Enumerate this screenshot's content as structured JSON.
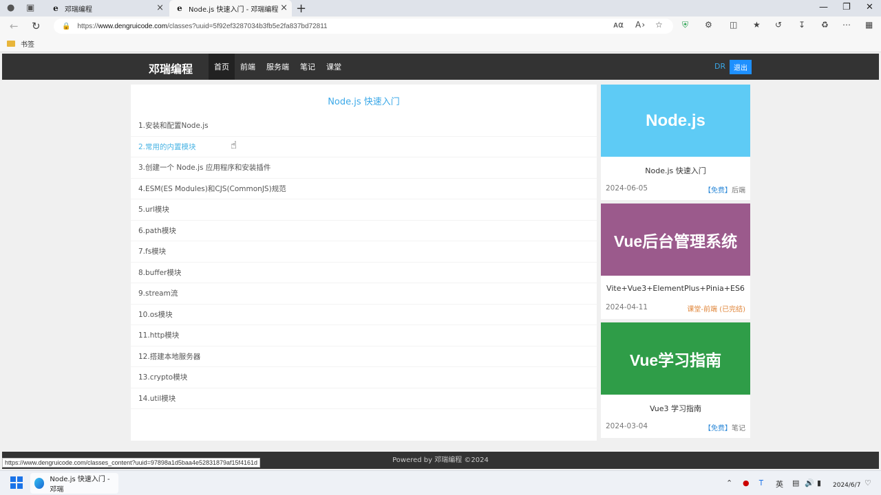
{
  "browser": {
    "tabs": [
      {
        "label": "邓瑞编程"
      },
      {
        "label": "Node.js 快速入门 - 邓瑞编程"
      }
    ],
    "url_prefix": "https://",
    "url_domain": "www.dengruicode.com",
    "url_rest": "/classes?uuid=5f92ef3287034b3fb5e2fa837bd72811",
    "bookmark_folder": "书签"
  },
  "site": {
    "logo": "邓瑞编程",
    "nav": [
      "首页",
      "前端",
      "服务端",
      "笔记",
      "课堂"
    ],
    "user": "DR",
    "logout": "退出"
  },
  "course": {
    "title": "Node.js 快速入门",
    "lessons": [
      "1.安装和配置Node.js",
      "2.常用的内置模块",
      "3.创建一个 Node.js 应用程序和安装插件",
      "4.ESM(ES Modules)和CJS(CommonJS)规范",
      "5.url模块",
      "6.path模块",
      "7.fs模块",
      "8.buffer模块",
      "9.stream流",
      "10.os模块",
      "11.http模块",
      "12.搭建本地服务器",
      "13.crypto模块",
      "14.util模块"
    ]
  },
  "sidebar": {
    "cards": [
      {
        "banner": "Node.js",
        "banner_color": "#5ecbf5",
        "title": "Node.js 快速入门",
        "date": "2024-06-05",
        "tag_blue": "【免费】",
        "tag_rest": "后端"
      },
      {
        "banner": "Vue后台管理系统",
        "banner_color": "#9b5a8c",
        "title": "Vite+Vue3+ElementPlus+Pinia+ES6",
        "date": "2024-04-11",
        "tag_orange": "课堂-前端 (已完结)"
      },
      {
        "banner": "Vue学习指南",
        "banner_color": "#2f9d48",
        "title": "Vue3 学习指南",
        "date": "2024-03-04",
        "tag_blue": "【免费】",
        "tag_rest": "笔记"
      }
    ]
  },
  "footer": "Powered by 邓瑞编程 ©2024",
  "status_url": "https://www.dengruicode.com/classes_content?uuid=97898a1d5baa4e52831879af15f4161d",
  "taskbar": {
    "app_label": "Node.js 快速入门 - 邓瑞",
    "ime": "英",
    "date": "2024/6/7"
  }
}
